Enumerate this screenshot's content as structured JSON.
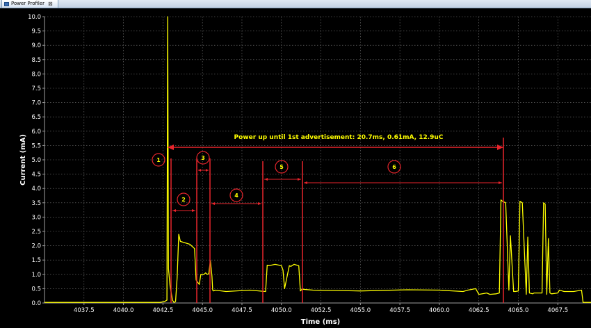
{
  "tab": {
    "label": "Power Profiler",
    "close_glyph": "⊠"
  },
  "chart_data": {
    "type": "line",
    "title": "",
    "xlabel": "Time (ms)",
    "ylabel": "Current (mA)",
    "xlim": [
      4035.0,
      4069.6
    ],
    "ylim": [
      0,
      10
    ],
    "grid": true,
    "x_ticks": [
      4037.5,
      4040.0,
      4042.5,
      4045.0,
      4047.5,
      4050.0,
      4052.5,
      4055.0,
      4057.5,
      4060.0,
      4062.5,
      4065.0,
      4067.5
    ],
    "x_tick_labels": [
      "4037.5",
      "4040.0",
      "4042.5",
      "4045.0",
      "4047.5",
      "4050.0",
      "4052.5",
      "4055.0",
      "4057.5",
      "4060.0",
      "4062.5",
      "4065.0",
      "4067.5"
    ],
    "y_ticks": [
      0,
      0.5,
      1,
      1.5,
      2,
      2.5,
      3,
      3.5,
      4,
      4.5,
      5,
      5.5,
      6,
      6.5,
      7,
      7.5,
      8,
      8.5,
      9,
      9.5,
      10
    ],
    "y_tick_labels": [
      "0.0",
      "0.5",
      "1.0",
      "1.5",
      "2.0",
      "2.5",
      "3.0",
      "3.5",
      "4.0",
      "4.5",
      "5.0",
      "5.5",
      "6.0",
      "6.5",
      "7.0",
      "7.5",
      "8.0",
      "8.5",
      "9.0",
      "9.5",
      "10.0"
    ],
    "series": [
      {
        "color": "#ffff00",
        "x": [
          4035.0,
          4042.3,
          4042.6,
          4042.75,
          4042.8,
          4042.85,
          4042.95,
          4043.1,
          4043.2,
          4043.3,
          4043.4,
          4043.5,
          4043.6,
          4044.2,
          4044.5,
          4044.6,
          4044.8,
          4044.9,
          4045.0,
          4045.1,
          4045.2,
          4045.3,
          4045.4,
          4045.5,
          4045.6,
          4045.65,
          4045.7,
          4045.8,
          4046.5,
          4048.0,
          4049.0,
          4049.1,
          4049.2,
          4049.6,
          4050.0,
          4050.1,
          4050.2,
          4050.5,
          4050.6,
          4050.8,
          4051.1,
          4051.2,
          4051.3,
          4052.0,
          4055.0,
          4058.0,
          4060.0,
          4061.5,
          4061.8,
          4062.3,
          4062.5,
          4063.0,
          4063.2,
          4063.6,
          4063.8,
          4063.9,
          4064.0,
          4064.2,
          4064.4,
          4064.5,
          4064.7,
          4064.8,
          4065.0,
          4065.1,
          4065.25,
          4065.5,
          4065.6,
          4065.7,
          4065.9,
          4066.0,
          4066.5,
          4066.6,
          4066.7,
          4066.8,
          4066.9,
          4067.0,
          4067.1,
          4067.5,
          4067.6,
          4067.9,
          4068.5,
          4069.0,
          4069.1,
          4069.6
        ],
        "y": [
          0.02,
          0.02,
          0.05,
          0.1,
          10.0,
          1.2,
          0.6,
          0.1,
          0.02,
          0.05,
          0.9,
          2.4,
          2.15,
          2.05,
          1.9,
          0.8,
          0.65,
          1.0,
          1.0,
          1.0,
          1.05,
          1.0,
          1.02,
          1.48,
          0.95,
          0.45,
          0.42,
          0.45,
          0.4,
          0.45,
          0.4,
          1.32,
          1.3,
          1.35,
          1.3,
          1.15,
          0.5,
          1.3,
          1.28,
          1.35,
          1.3,
          0.42,
          0.48,
          0.45,
          0.42,
          0.46,
          0.45,
          0.4,
          0.45,
          0.5,
          0.3,
          0.35,
          0.3,
          0.32,
          0.35,
          3.6,
          3.55,
          3.5,
          0.45,
          2.35,
          0.4,
          0.4,
          0.42,
          3.55,
          3.5,
          0.3,
          2.3,
          0.35,
          0.32,
          0.35,
          0.35,
          3.5,
          3.45,
          0.3,
          2.25,
          0.35,
          0.32,
          0.35,
          0.45,
          0.4,
          0.4,
          0.45,
          0.02,
          0.02
        ]
      }
    ],
    "annotations": [
      {
        "text": "Power up until 1st advertisement: 20.7ms, 0.61mA, 12.9uC",
        "color": "#ffff00"
      },
      {
        "text": "1"
      },
      {
        "text": "2"
      },
      {
        "text": "3"
      },
      {
        "text": "4"
      },
      {
        "text": "5"
      },
      {
        "text": "6"
      }
    ]
  }
}
